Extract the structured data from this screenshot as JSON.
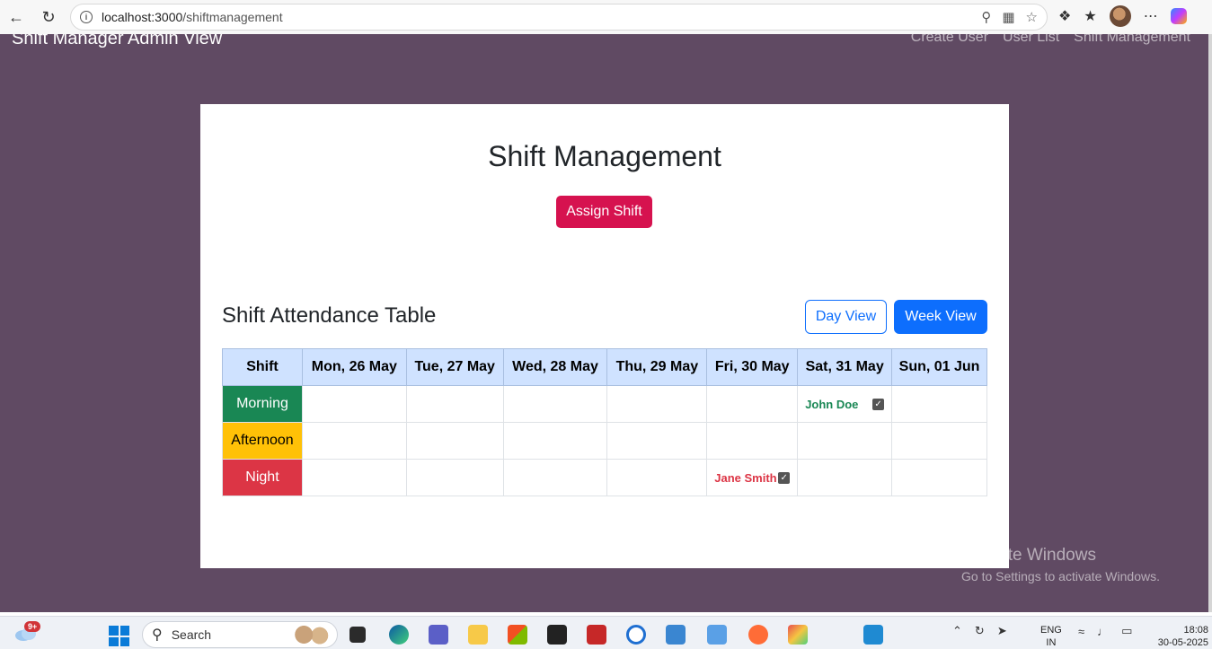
{
  "browser": {
    "url_host": "localhost:3000",
    "url_path": "/shiftmanagement"
  },
  "app": {
    "brand": "Shift Manager Admin View",
    "nav": [
      "Create User",
      "User List",
      "Shift Management"
    ]
  },
  "page": {
    "title": "Shift Management",
    "assign_label": "Assign Shift",
    "table_title": "Shift Attendance Table",
    "day_view_label": "Day View",
    "week_view_label": "Week View"
  },
  "table": {
    "headers": [
      "Shift",
      "Mon, 26 May",
      "Tue, 27 May",
      "Wed, 28 May",
      "Thu, 29 May",
      "Fri, 30 May",
      "Sat, 31 May",
      "Sun, 01 Jun"
    ],
    "rows": [
      {
        "shift": "Morning",
        "color": "#198754",
        "cells": [
          "",
          "",
          "",
          "",
          "",
          "John Doe",
          ""
        ]
      },
      {
        "shift": "Afternoon",
        "color": "#ffc107",
        "cells": [
          "",
          "",
          "",
          "",
          "",
          "",
          ""
        ]
      },
      {
        "shift": "Night",
        "color": "#dc3545",
        "cells": [
          "",
          "",
          "",
          "",
          "Jane Smith",
          "",
          ""
        ]
      }
    ]
  },
  "watermark": {
    "line1": "Activate Windows",
    "line2": "Go to Settings to activate Windows."
  },
  "taskbar": {
    "badge": "9+",
    "search_placeholder": "Search",
    "lang_top": "ENG",
    "lang_bottom": "IN",
    "time": "18:08",
    "date": "30-05-2025"
  }
}
